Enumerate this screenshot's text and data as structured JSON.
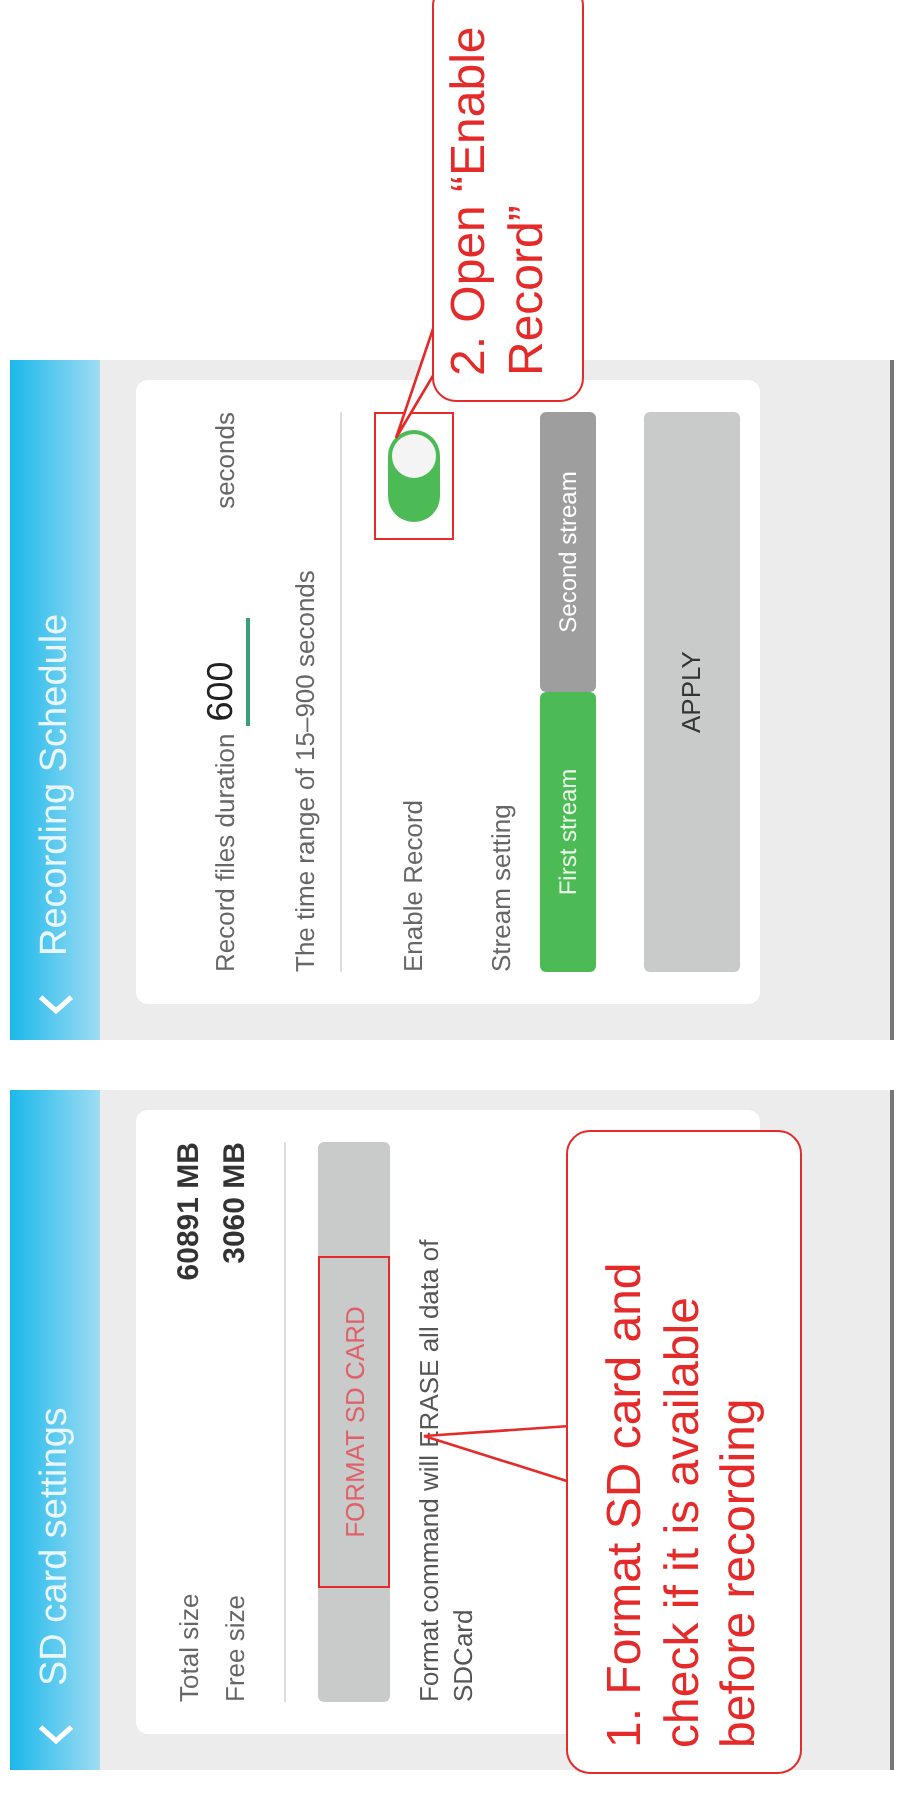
{
  "sd_screen": {
    "title": "SD card settings",
    "rows": [
      {
        "label": "Total size",
        "value": "60891 MB"
      },
      {
        "label": "Free size",
        "value": "3060 MB"
      }
    ],
    "format_button": "FORMAT SD CARD",
    "note": "Format command will ERASE all data of SDCard"
  },
  "record_screen": {
    "title": "Recording Schedule",
    "duration_label": "Record files duration",
    "duration_value": "600",
    "duration_unit": "seconds",
    "range_hint": "The time range of 15–900 seconds",
    "enable_label": "Enable Record",
    "enable_on": true,
    "stream_label": "Stream setting",
    "streams": [
      {
        "label": "First stream",
        "selected": true
      },
      {
        "label": "Second stream",
        "selected": false
      }
    ],
    "apply_button": "APPLY"
  },
  "callouts": [
    {
      "lines": [
        "1. Format SD card and",
        "check if it is available",
        "before recording"
      ]
    },
    {
      "lines": [
        "2. Open “Enable",
        "Record”"
      ]
    }
  ]
}
